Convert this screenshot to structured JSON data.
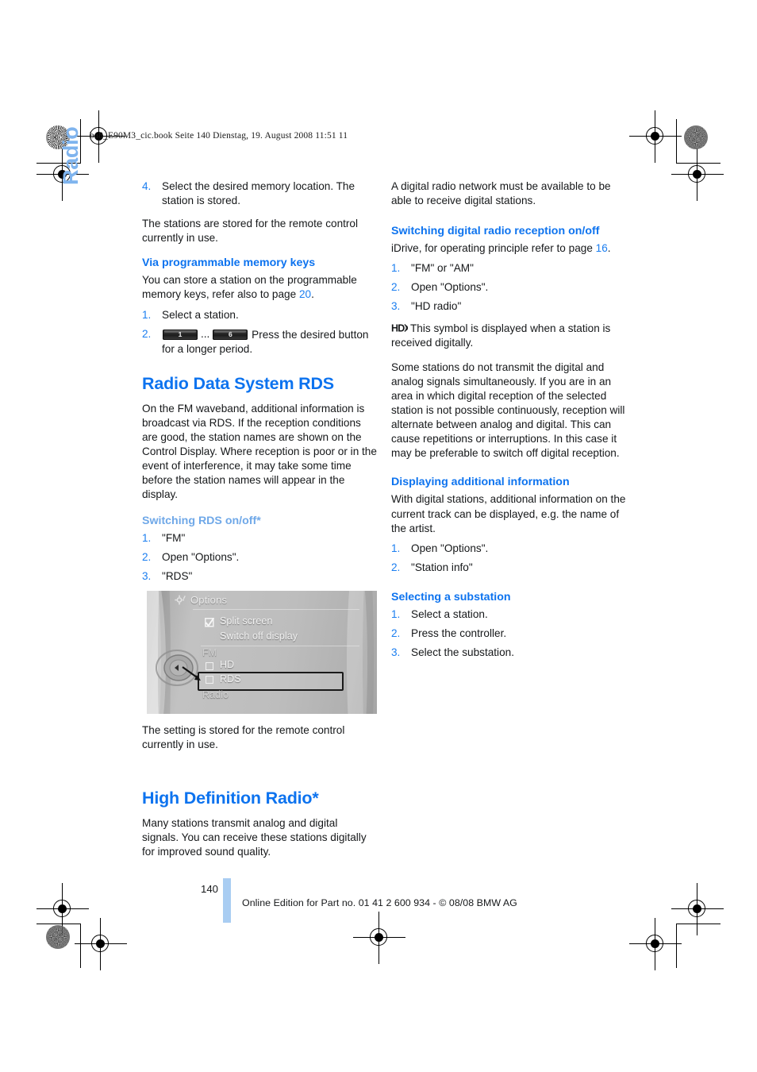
{
  "running_header": "ba8_E90M3_cic.book  Seite 140  Dienstag, 19. August 2008  11:51 11",
  "side_tab": "Radio",
  "colors": {
    "heading_blue": "#0d73ef",
    "faded_heading_blue": "#6fa8e8",
    "side_tab_blue": "#7fb4ee",
    "number_blue": "#1b7ef0",
    "page_bar_blue": "#a9cdf2"
  },
  "left_column": {
    "step4": {
      "num": "4.",
      "text": "Select the desired memory location. The station is stored."
    },
    "para_stored": "The stations are stored for the remote control currently in use.",
    "memkeys_heading": "Via programmable memory keys",
    "memkeys_intro_a": "You can store a station on the programmable memory keys, refer also to page ",
    "memkeys_intro_page": "20",
    "memkeys_intro_b": ".",
    "memkeys_step1_num": "1.",
    "memkeys_step1": "Select a station.",
    "memkeys_step2_num": "2.",
    "memkeys_step2_text": "Press the desired button for a longer period.",
    "memkey_first_label": "1",
    "memkey_last_label": "6",
    "memkey_ellipsis": "...",
    "rds_heading": "Radio Data System RDS",
    "rds_para": "On the FM waveband, additional information is broadcast via RDS. If the reception conditions are good, the station names are shown on the Control Display. Where reception is poor or in the event of interference, it may take some time before the station names will appear in the display.",
    "rds_switch_heading": "Switching RDS on/off*",
    "rds_steps": [
      {
        "num": "1.",
        "text": "\"FM\""
      },
      {
        "num": "2.",
        "text": "Open \"Options\"."
      },
      {
        "num": "3.",
        "text": "\"RDS\""
      }
    ],
    "rds_after_shot": "The setting is stored for the remote control currently in use.",
    "hd_heading": "High Definition Radio*",
    "hd_para": "Many stations transmit analog and digital signals. You can receive these stations digitally for improved sound quality."
  },
  "idrive_screenshot": {
    "title": "Options",
    "title_icon": "options-gear-icon",
    "items": [
      {
        "label": "Split screen",
        "control": "checkbox-checked"
      },
      {
        "label": "Switch off display",
        "control": "none"
      },
      {
        "label": "FM",
        "control": "group-label"
      },
      {
        "label": "HD",
        "control": "checkbox-unchecked"
      },
      {
        "label": "RDS",
        "control": "checkbox-unchecked",
        "highlighted": true
      },
      {
        "label": "Radio",
        "control": "group-label"
      }
    ]
  },
  "right_column": {
    "para_network": "A digital radio network must be available to be able to receive digital stations.",
    "switch_heading": "Switching digital radio reception on/off",
    "idrive_ref_a": "iDrive, for operating principle refer to page ",
    "idrive_ref_page": "16",
    "idrive_ref_b": ".",
    "switch_steps": [
      {
        "num": "1.",
        "text": "\"FM\" or \"AM\""
      },
      {
        "num": "2.",
        "text": "Open \"Options\"."
      },
      {
        "num": "3.",
        "text": "\"HD radio\""
      }
    ],
    "hd_symbol_icon": "hd-radio-logo-icon",
    "hd_symbol_text": "This symbol is displayed when a station is received digitally.",
    "para_simultaneous": "Some stations do not transmit the digital and analog signals simultaneously. If you are in an area in which digital reception of the selected station is not possible continuously, reception will alternate between analog and digital. This can cause repetitions or interruptions. In this case it may be preferable to switch off digital reception.",
    "addinfo_heading": "Displaying additional information",
    "addinfo_para": "With digital stations, additional information on the current track can be displayed, e.g. the name of the artist.",
    "addinfo_steps": [
      {
        "num": "1.",
        "text": "Open \"Options\"."
      },
      {
        "num": "2.",
        "text": "\"Station info\""
      }
    ],
    "substation_heading": "Selecting a substation",
    "substation_steps": [
      {
        "num": "1.",
        "text": "Select a station."
      },
      {
        "num": "2.",
        "text": "Press the controller."
      },
      {
        "num": "3.",
        "text": "Select the substation."
      }
    ]
  },
  "footer": {
    "page_number": "140",
    "copyright": "Online Edition for Part no. 01 41 2 600 934 - © 08/08 BMW AG"
  }
}
